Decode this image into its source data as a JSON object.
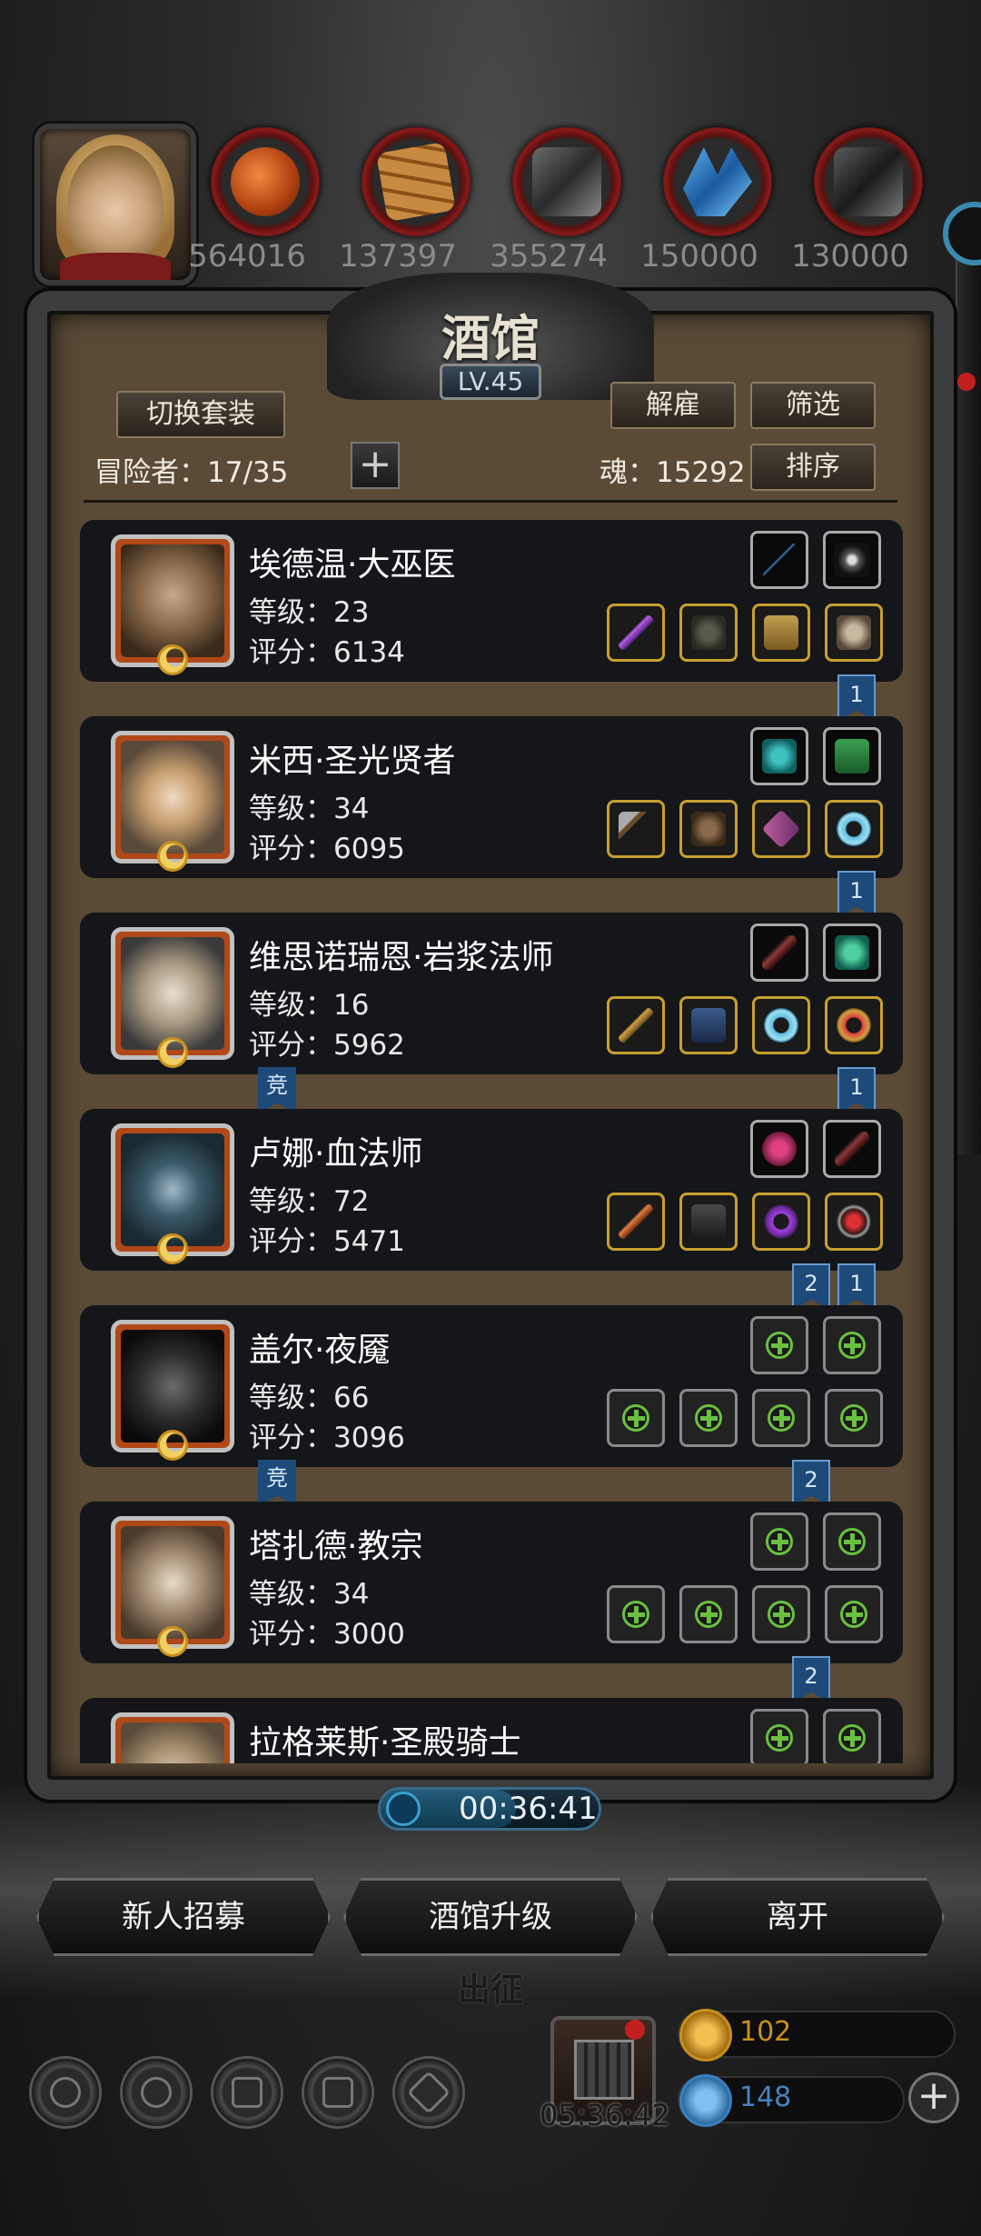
{
  "resources": [
    {
      "name": "copper-ore",
      "value": "564016",
      "icon": "ore-icon"
    },
    {
      "name": "wood",
      "value": "137397",
      "icon": "wood-icon"
    },
    {
      "name": "iron",
      "value": "355274",
      "icon": "iron-icon"
    },
    {
      "name": "crystal",
      "value": "150000",
      "icon": "crystal-icon"
    },
    {
      "name": "stone",
      "value": "130000",
      "icon": "stone-icon"
    }
  ],
  "panel": {
    "title": "酒馆",
    "level": "LV.45",
    "switch_outfit": "切换套装",
    "dismiss": "解雇",
    "filter": "筛选",
    "sort": "排序",
    "adventurers": "冒险者：17/35",
    "soul": "魂：15292"
  },
  "heroes": [
    {
      "name": "埃德温·大巫医",
      "level": "等级：23",
      "score": "评分：6134",
      "tag": "1",
      "comp": ""
    },
    {
      "name": "米西·圣光贤者",
      "level": "等级：34",
      "score": "评分：6095",
      "tag": "1",
      "comp": ""
    },
    {
      "name": "维思诺瑞恩·岩浆法师",
      "level": "等级：16",
      "score": "评分：5962",
      "tag": "1",
      "comp": "竞"
    },
    {
      "name": "卢娜·血法师",
      "level": "等级：72",
      "score": "评分：5471",
      "tag": "1",
      "tag2": "2",
      "comp": ""
    },
    {
      "name": "盖尔·夜魇",
      "level": "等级：66",
      "score": "评分：3096",
      "tag": "2",
      "comp": "竞"
    },
    {
      "name": "塔扎德·教宗",
      "level": "等级：34",
      "score": "评分：3000",
      "tag": "2",
      "comp": ""
    },
    {
      "name": "拉格莱斯·圣殿骑士",
      "level": "",
      "score": "",
      "tag": "",
      "comp": ""
    }
  ],
  "timer": "00:36:41",
  "buttons": {
    "recruit": "新人招募",
    "upgrade": "酒馆升级",
    "leave": "离开"
  },
  "expedition": "出征",
  "gift_timer": "05:36:42",
  "currency": {
    "gold": "102",
    "gems": "148"
  },
  "colors": {
    "panel_bg": "#5a4a36",
    "card_bg": "#14161a",
    "gold_border": "#c8a030",
    "tag_blue": "#1e4a7a"
  }
}
